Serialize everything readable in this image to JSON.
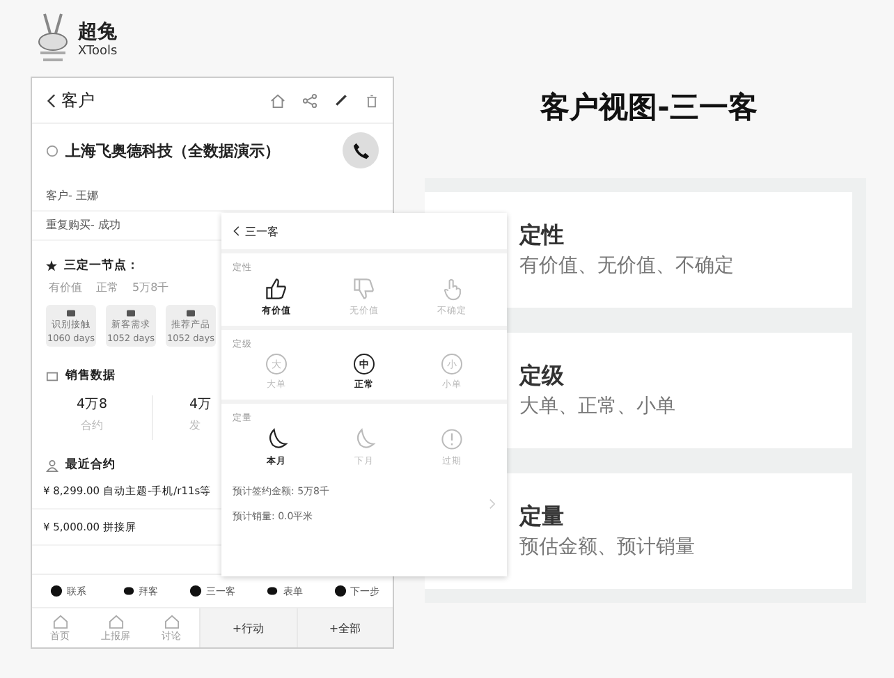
{
  "logo": {
    "name": "超兔",
    "sub": "XTools"
  },
  "customer": {
    "title": "客户",
    "company": "上海飞奥德科技（全数据演示）",
    "fields": [
      "客户- 王娜",
      "重复购买- 成功"
    ]
  },
  "nodes": {
    "title": "三定一节点：",
    "values": [
      "有价值",
      "正常",
      "5万8千"
    ]
  },
  "tiles": [
    {
      "label": "识别接触",
      "days": "1060 days"
    },
    {
      "label": "新客需求",
      "days": "1052 days"
    },
    {
      "label": "推荐产品",
      "days": "1052 days"
    }
  ],
  "sales": {
    "title": "销售数据",
    "stats": [
      {
        "value": "4万8",
        "label": "合约"
      },
      {
        "value": "4万",
        "label": "发"
      }
    ]
  },
  "contracts": {
    "title": "最近合约",
    "rows": [
      "¥ 8,299.00 自动主题-手机/r11s等",
      "¥ 5,000.00 拼接屏"
    ]
  },
  "actions": [
    "联系",
    "拜客",
    "三一客",
    "表单",
    "下一步"
  ],
  "tabbar": {
    "tabs": [
      "首页",
      "上报屏",
      "讨论"
    ],
    "buttons": [
      "+行动",
      "+全部"
    ]
  },
  "popup": {
    "title": "三一客",
    "sections": [
      {
        "title": "定性",
        "kind": "thumb",
        "options": [
          {
            "label": "有价值",
            "selected": true
          },
          {
            "label": "无价值",
            "selected": false
          },
          {
            "label": "不确定",
            "selected": false
          }
        ]
      },
      {
        "title": "定级",
        "kind": "grade",
        "options": [
          {
            "label": "大单",
            "selected": false,
            "mark": "大"
          },
          {
            "label": "正常",
            "selected": true,
            "mark": "中"
          },
          {
            "label": "小单",
            "selected": false,
            "mark": "小"
          }
        ]
      },
      {
        "title": "定量",
        "kind": "time",
        "options": [
          {
            "label": "本月",
            "selected": true
          },
          {
            "label": "下月",
            "selected": false
          },
          {
            "label": "过期",
            "selected": false
          }
        ]
      }
    ],
    "estimates": [
      "预计签约金额: 5万8千",
      "预计销量: 0.0平米"
    ]
  },
  "slide": {
    "title": "客户视图-三一客",
    "cards": [
      {
        "title": "定性",
        "text": "有价值、无价值、不确定"
      },
      {
        "title": "定级",
        "text": "大单、正常、小单"
      },
      {
        "title": "定量",
        "text": "预估金额、预计销量"
      }
    ]
  }
}
